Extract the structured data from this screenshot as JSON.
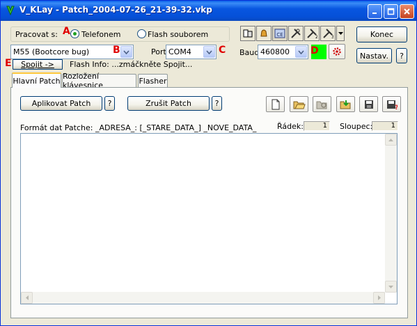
{
  "window": {
    "title": "V_KLay - Patch_2004-07-26_21-39-32.vkp"
  },
  "top": {
    "pracovat_label": "Pracovat s:",
    "radio_phone": "Telefonem",
    "radio_flash": "Flash souborem",
    "model_value": "M55 (Bootcore bug)",
    "port_label": "Port",
    "port_value": "COM4",
    "baud_label": "Baud",
    "baud_value": "460800",
    "connect_button": "Spojit ->",
    "flash_info": "Flash Info: ...zmáčkněte Spojit...",
    "konec_button": "Konec",
    "nastav_button": "Nastav.",
    "help_q": "?",
    "markers": {
      "A": "A",
      "B": "B",
      "C": "C",
      "D": "D",
      "E": "E"
    },
    "status_color": "#00ff00"
  },
  "tabs": [
    {
      "label": "Hlavní Patch"
    },
    {
      "label": "Rozložení klávesnice"
    },
    {
      "label": "Flasher"
    }
  ],
  "panel": {
    "apply_button": "Aplikovat Patch",
    "cancel_button": "Zrušit Patch",
    "help_q": "?",
    "format_label": "Formát dat Patche: _ADRESA_: [_STARE_DATA_] _NOVE_DATA_",
    "row_label": "Řádek:",
    "row_value": "1",
    "col_label": "Sloupec:",
    "col_value": "1",
    "editor_text": ""
  },
  "colors": {
    "accent": "#0a5fe9",
    "marker": "#e00000"
  }
}
